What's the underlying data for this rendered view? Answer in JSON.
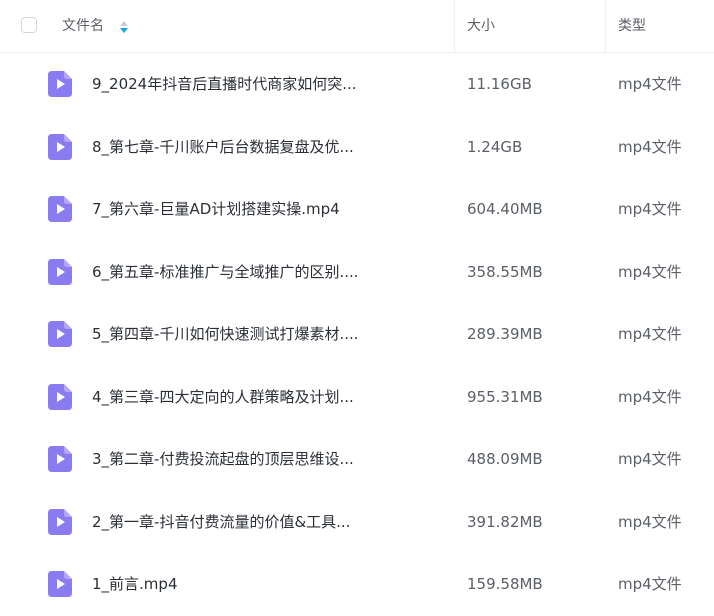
{
  "header": {
    "name_label": "文件名",
    "size_label": "大小",
    "type_label": "类型"
  },
  "colors": {
    "icon_purple": "#8b7bf0",
    "sort_active": "#1aa3f0"
  },
  "files": [
    {
      "name": "9_2024年抖音后直播时代商家如何突...",
      "size": "11.16GB",
      "type": "mp4文件",
      "icon": "video-file-icon"
    },
    {
      "name": "8_第七章-千川账户后台数据复盘及优...",
      "size": "1.24GB",
      "type": "mp4文件",
      "icon": "video-file-icon"
    },
    {
      "name": "7_第六章-巨量AD计划搭建实操.mp4",
      "size": "604.40MB",
      "type": "mp4文件",
      "icon": "video-file-icon"
    },
    {
      "name": "6_第五章-标准推广与全域推广的区别....",
      "size": "358.55MB",
      "type": "mp4文件",
      "icon": "video-file-icon"
    },
    {
      "name": "5_第四章-千川如何快速测试打爆素材....",
      "size": "289.39MB",
      "type": "mp4文件",
      "icon": "video-file-icon"
    },
    {
      "name": "4_第三章-四大定向的人群策略及计划...",
      "size": "955.31MB",
      "type": "mp4文件",
      "icon": "video-file-icon"
    },
    {
      "name": "3_第二章-付费投流起盘的顶层思维设...",
      "size": "488.09MB",
      "type": "mp4文件",
      "icon": "video-file-icon"
    },
    {
      "name": "2_第一章-抖音付费流量的价值&工具...",
      "size": "391.82MB",
      "type": "mp4文件",
      "icon": "video-file-icon"
    },
    {
      "name": "1_前言.mp4",
      "size": "159.58MB",
      "type": "mp4文件",
      "icon": "video-file-icon"
    }
  ]
}
